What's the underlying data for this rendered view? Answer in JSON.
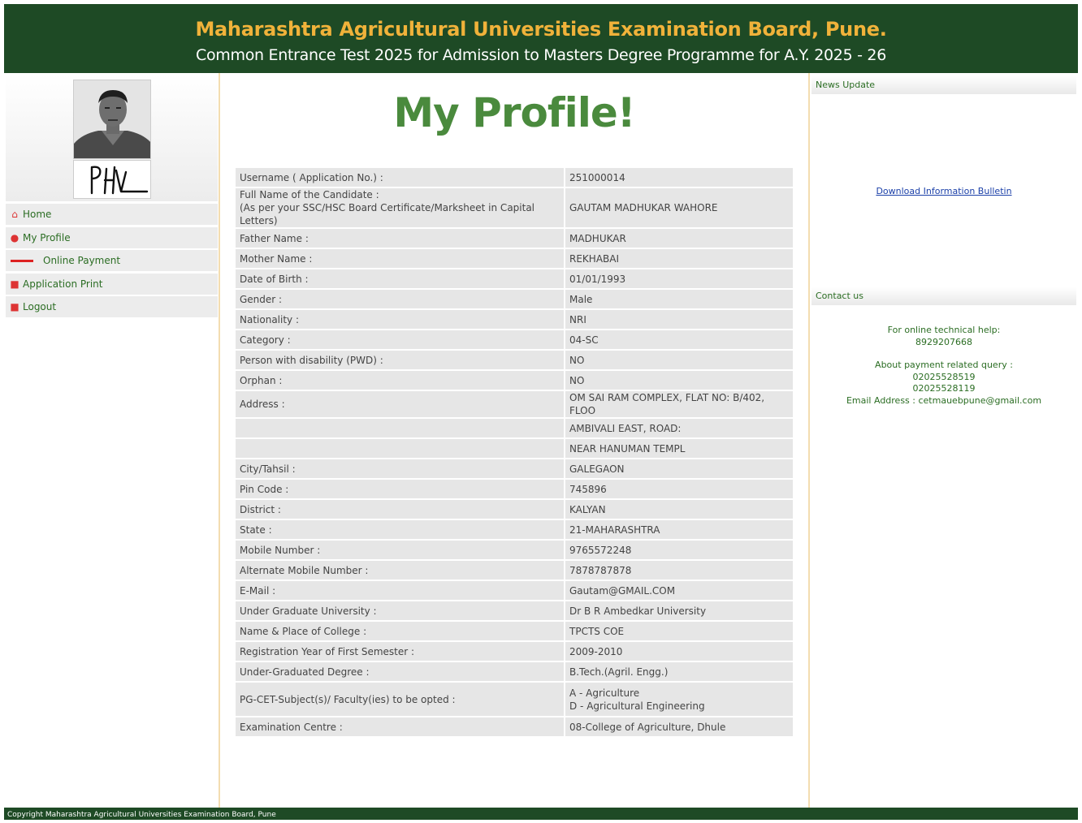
{
  "header": {
    "title": "Maharashtra Agricultural Universities Examination Board, Pune.",
    "subtitle": "Common Entrance Test 2025 for Admission to Masters Degree Programme for A.Y. 2025 - 26"
  },
  "sidebar": {
    "items": [
      {
        "label": "Home",
        "icon": "home-icon"
      },
      {
        "label": "My Profile",
        "icon": "user-icon"
      },
      {
        "label": "Online Payment",
        "icon": "dash-icon"
      },
      {
        "label": "Application Print",
        "icon": "print-icon"
      },
      {
        "label": "Logout",
        "icon": "logout-icon"
      }
    ]
  },
  "main": {
    "title": "My Profile!",
    "rows": [
      {
        "label": "Username ( Application No.) :",
        "value": "251000014"
      },
      {
        "label": "Full Name of the Candidate :",
        "label2": "(As per your SSC/HSC Board Certificate/Marksheet in Capital Letters)",
        "value": "GAUTAM MADHUKAR WAHORE"
      },
      {
        "label": "Father Name :",
        "value": "MADHUKAR"
      },
      {
        "label": "Mother Name :",
        "value": "REKHABAI"
      },
      {
        "label": "Date of Birth :",
        "value": "01/01/1993"
      },
      {
        "label": "Gender :",
        "value": "Male"
      },
      {
        "label": "Nationality :",
        "value": "NRI"
      },
      {
        "label": "Category :",
        "value": "04-SC"
      },
      {
        "label": "Person with disability (PWD) :",
        "value": "NO"
      },
      {
        "label": "Orphan :",
        "value": "NO"
      },
      {
        "label": "Address :",
        "value": "OM SAI RAM COMPLEX, FLAT NO: B/402, FLOO"
      },
      {
        "label": "",
        "value": "AMBIVALI EAST, ROAD:"
      },
      {
        "label": "",
        "value": "NEAR HANUMAN TEMPL"
      },
      {
        "label": "City/Tahsil :",
        "value": "GALEGAON"
      },
      {
        "label": "Pin Code :",
        "value": "745896"
      },
      {
        "label": "District :",
        "value": "KALYAN"
      },
      {
        "label": "State :",
        "value": "21-MAHARASHTRA"
      },
      {
        "label": "Mobile Number :",
        "value": "9765572248"
      },
      {
        "label": "Alternate Mobile Number :",
        "value": "7878787878"
      },
      {
        "label": "E-Mail :",
        "value": "Gautam@GMAIL.COM"
      },
      {
        "label": "Under Graduate University :",
        "value": "Dr B R Ambedkar University"
      },
      {
        "label": "Name & Place of College :",
        "value": "TPCTS COE"
      },
      {
        "label": "Registration Year of First Semester :",
        "value": "2009-2010"
      },
      {
        "label": "Under-Graduated Degree :",
        "value": "B.Tech.(Agril. Engg.)"
      },
      {
        "label": "PG-CET-Subject(s)/ Faculty(ies) to be opted :",
        "value": "A - Agriculture",
        "value2": "D - Agricultural Engineering"
      },
      {
        "label": "Examination Centre :",
        "value": "08-College of Agriculture, Dhule"
      }
    ]
  },
  "right": {
    "news_title": "News Update",
    "download_link": "Download Information Bulletin",
    "contact_title": "Contact us",
    "tech_help_label": "For online technical help:",
    "tech_help_phone": "8929207668",
    "payment_label": "About payment related query :",
    "payment_phone1": "02025528519",
    "payment_phone2": "02025528119",
    "email_line": "Email Address : cetmauebpune@gmail.com"
  },
  "footer": {
    "text": "Copyright Maharashtra Agricultural Universities Examination Board, Pune"
  },
  "colors": {
    "header_bg": "#1e4a25",
    "header_title": "#f0b23a",
    "accent_green": "#4a8a3d",
    "link_blue": "#1a3fa8",
    "menu_icon_red": "#d33333"
  }
}
